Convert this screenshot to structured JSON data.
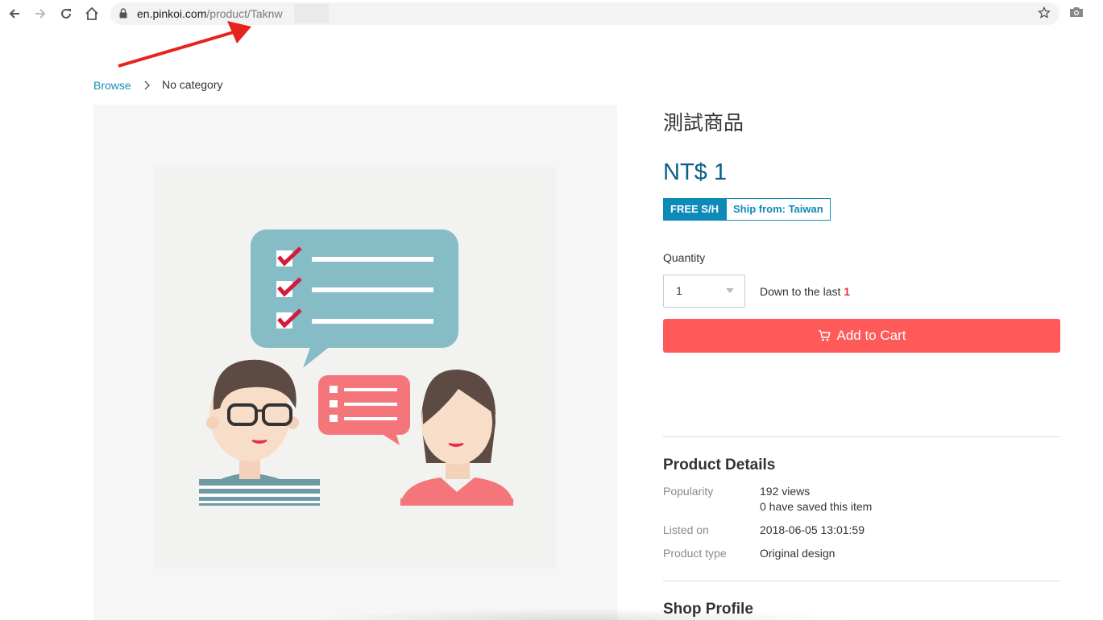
{
  "browser": {
    "url_domain": "en.pinkoi.com",
    "url_path": "/product/Taknw",
    "icons": [
      "back-icon",
      "forward-icon",
      "reload-icon",
      "home-icon",
      "lock-icon",
      "star-icon",
      "camera-icon"
    ]
  },
  "breadcrumb": {
    "browse": "Browse",
    "current": "No category"
  },
  "product": {
    "title": "測試商品",
    "price": "NT$ 1",
    "badge_free": "FREE S/H",
    "badge_ship": "Ship from: Taiwan",
    "quantity_label": "Quantity",
    "quantity_value": "1",
    "stock_prefix": "Down to the last",
    "stock_count": "1",
    "add_to_cart": "Add to Cart"
  },
  "details": {
    "title": "Product Details",
    "popularity_label": "Popularity",
    "views": "192 views",
    "saved": "0 have saved this item",
    "listed_label": "Listed on",
    "listed_value": "2018-06-05 13:01:59",
    "type_label": "Product type",
    "type_value": "Original design"
  },
  "shop": {
    "title": "Shop Profile"
  },
  "colors": {
    "accent_blue": "#0e8ab8",
    "price_blue": "#0b5f8a",
    "cart_red": "#ff5a5a",
    "annotation_red": "#e8221c"
  }
}
